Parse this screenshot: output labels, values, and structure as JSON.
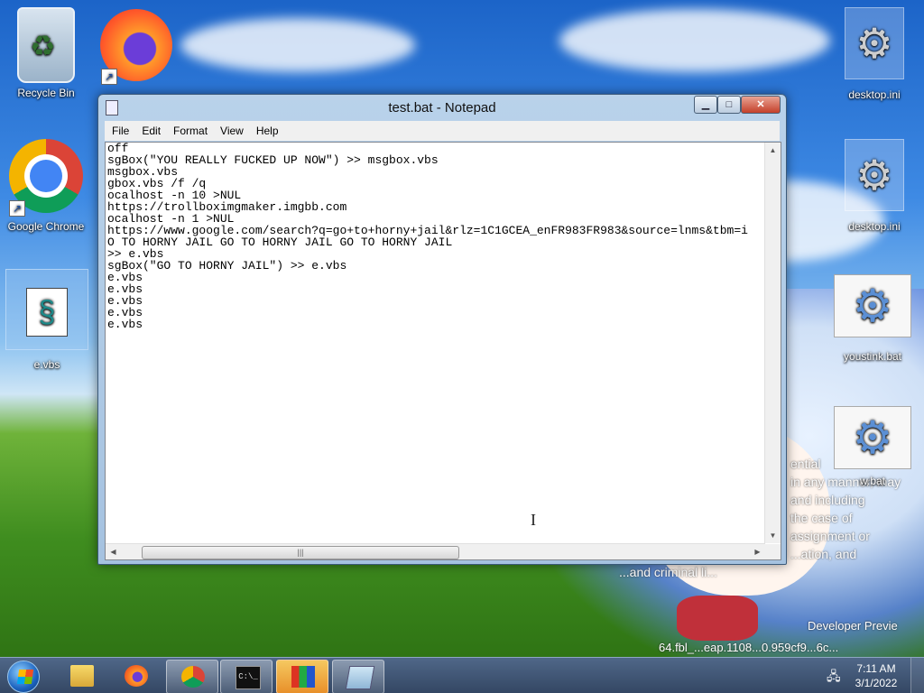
{
  "desktop": {
    "icons": [
      {
        "label": "Recycle Bin"
      },
      {
        "label": "Google Chrome"
      },
      {
        "label": "e.vbs"
      },
      {
        "label": "desktop.ini"
      },
      {
        "label": "desktop.ini"
      },
      {
        "label": "youstink.bat"
      },
      {
        "label": "w.bat"
      }
    ],
    "overlay_lines": [
      "ential",
      "in any manner, may",
      "and including",
      "the case of",
      "assignment or",
      "...ation, and",
      "...and criminal li..."
    ],
    "watermark": {
      "line1": "Developer Previe",
      "line2": "64.fbl_...eap.1108...0.959cf9...6c..."
    }
  },
  "notepad": {
    "title": "test.bat - Notepad",
    "menu": [
      "File",
      "Edit",
      "Format",
      "View",
      "Help"
    ],
    "controls": {
      "minimize": "▁",
      "maximize": "□",
      "close": "✕"
    },
    "content": "off\nsgBox(\"YOU REALLY FUCKED UP NOW\") >> msgbox.vbs\nmsgbox.vbs\ngbox.vbs /f /q\nocalhost -n 10 >NUL\nhttps://trollboximgmaker.imgbb.com\nocalhost -n 1 >NUL\nhttps://www.google.com/search?q=go+to+horny+jail&rlz=1C1GCEA_enFR983FR983&source=lnms&tbm=i\nO TO HORNY JAIL GO TO HORNY JAIL GO TO HORNY JAIL\n>> e.vbs\nsgBox(\"GO TO HORNY JAIL\") >> e.vbs\ne.vbs\ne.vbs\ne.vbs\ne.vbs\ne.vbs",
    "scroll": {
      "up": "▲",
      "down": "▼",
      "left": "◀",
      "right": "▶",
      "grip": "|||"
    }
  },
  "taskbar": {
    "apps": [
      "explorer",
      "firefox",
      "chrome",
      "cmd",
      "app",
      "notepad"
    ],
    "active_app": "notepad",
    "clock": {
      "time": "7:11 AM",
      "date": "3/1/2022"
    }
  }
}
